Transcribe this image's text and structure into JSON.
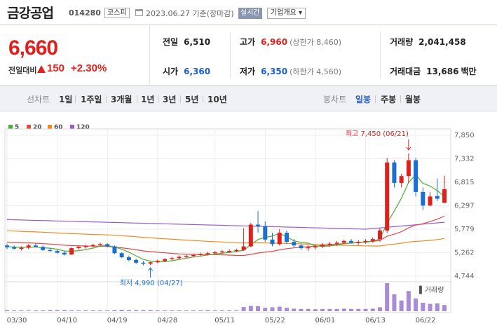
{
  "header": {
    "name": "금강공업",
    "code": "014280",
    "market": "코스피",
    "date": "2023.06.27 기준(장마감)",
    "realtime": "실시간",
    "overview": "기업개요 ▾"
  },
  "price": {
    "current": "6,660",
    "diff_label": "전일대비",
    "diff": "150",
    "rate": "+2.30%"
  },
  "stats": {
    "prev_label": "전일",
    "prev": "6,510",
    "high_label": "고가",
    "high": "6,960",
    "upper": "(상한가 8,460)",
    "volume_label": "거래량",
    "volume": "2,041,458",
    "open_label": "시가",
    "open": "6,360",
    "low_label": "저가",
    "low": "6,350",
    "lower": "(하한가 4,560)",
    "amount_label": "거래대금",
    "amount": "13,686",
    "amount_unit": "백만"
  },
  "tabs": {
    "line_label": "선차트",
    "line": [
      "1일",
      "1주일",
      "3개월",
      "1년",
      "3년",
      "5년",
      "10년"
    ],
    "candle_label": "봉차트",
    "candle": [
      "일봉",
      "주봉",
      "월봉"
    ]
  },
  "colors": {
    "up": "#e0201d",
    "down": "#1b6fd0",
    "ma5": "#4caf34",
    "ma20": "#e24a4a",
    "ma60": "#f08a1e",
    "ma120": "#9a5cc8",
    "volume": "#a98bd6"
  },
  "chart_data": {
    "type": "candlestick",
    "legend": [
      "5",
      "20",
      "60",
      "120"
    ],
    "y_ticks": [
      "7,850",
      "7,332",
      "6,815",
      "6,297",
      "5,779",
      "5,262",
      "4,744"
    ],
    "ylim": [
      4744,
      7850
    ],
    "x_ticks": [
      "03/30",
      "04/10",
      "04/19",
      "04/28",
      "05/11",
      "05/22",
      "06/01",
      "06/13",
      "06/22"
    ],
    "x_tick_index": [
      0,
      7,
      14,
      21,
      29,
      36,
      43,
      50,
      57
    ],
    "max_label": "최고 7,450 (06/21)",
    "max_index": 56,
    "max_value": 7450,
    "min_label": "최저 4,990 (04/27)",
    "min_index": 20,
    "min_value": 4990,
    "volume_label": "거래량",
    "candles": [
      [
        5420,
        5460,
        5340,
        5380
      ],
      [
        5380,
        5420,
        5330,
        5350
      ],
      [
        5350,
        5400,
        5310,
        5370
      ],
      [
        5370,
        5450,
        5340,
        5420
      ],
      [
        5420,
        5470,
        5380,
        5390
      ],
      [
        5390,
        5420,
        5300,
        5320
      ],
      [
        5320,
        5360,
        5280,
        5300
      ],
      [
        5300,
        5340,
        5240,
        5260
      ],
      [
        5260,
        5300,
        5200,
        5220
      ],
      [
        5220,
        5380,
        5210,
        5360
      ],
      [
        5360,
        5420,
        5330,
        5390
      ],
      [
        5390,
        5440,
        5350,
        5410
      ],
      [
        5410,
        5460,
        5380,
        5430
      ],
      [
        5430,
        5480,
        5400,
        5450
      ],
      [
        5450,
        5470,
        5380,
        5400
      ],
      [
        5400,
        5420,
        5230,
        5250
      ],
      [
        5250,
        5270,
        5140,
        5160
      ],
      [
        5160,
        5200,
        5070,
        5100
      ],
      [
        5100,
        5130,
        5010,
        5040
      ],
      [
        5040,
        5080,
        4980,
        5020
      ],
      [
        5020,
        5060,
        4990,
        5050
      ],
      [
        5050,
        5110,
        5030,
        5080
      ],
      [
        5080,
        5140,
        5060,
        5120
      ],
      [
        5120,
        5170,
        5090,
        5140
      ],
      [
        5140,
        5200,
        5110,
        5170
      ],
      [
        5170,
        5220,
        5140,
        5190
      ],
      [
        5190,
        5240,
        5160,
        5210
      ],
      [
        5210,
        5260,
        5180,
        5230
      ],
      [
        5230,
        5280,
        5200,
        5250
      ],
      [
        5250,
        5300,
        5220,
        5270
      ],
      [
        5270,
        5320,
        5240,
        5290
      ],
      [
        5290,
        5340,
        5260,
        5300
      ],
      [
        5300,
        5350,
        5270,
        5320
      ],
      [
        5320,
        5800,
        5300,
        5400
      ],
      [
        5400,
        5920,
        5380,
        5880
      ],
      [
        5880,
        6180,
        5700,
        5850
      ],
      [
        5850,
        5950,
        5500,
        5550
      ],
      [
        5550,
        5700,
        5400,
        5450
      ],
      [
        5450,
        5780,
        5420,
        5700
      ],
      [
        5700,
        5750,
        5450,
        5500
      ],
      [
        5500,
        5560,
        5380,
        5420
      ],
      [
        5420,
        5460,
        5320,
        5360
      ],
      [
        5360,
        5420,
        5300,
        5380
      ],
      [
        5380,
        5440,
        5330,
        5400
      ],
      [
        5400,
        5470,
        5360,
        5440
      ],
      [
        5440,
        5500,
        5390,
        5460
      ],
      [
        5460,
        5520,
        5410,
        5480
      ],
      [
        5480,
        5550,
        5450,
        5520
      ],
      [
        5520,
        5560,
        5460,
        5480
      ],
      [
        5480,
        5540,
        5440,
        5500
      ],
      [
        5500,
        5560,
        5460,
        5520
      ],
      [
        5520,
        5600,
        5480,
        5560
      ],
      [
        5560,
        5800,
        5500,
        5750
      ],
      [
        5750,
        7350,
        5700,
        7250
      ],
      [
        7250,
        7300,
        6700,
        6800
      ],
      [
        6800,
        7000,
        6700,
        6950
      ],
      [
        6950,
        7450,
        6800,
        7300
      ],
      [
        7300,
        7350,
        6500,
        6600
      ],
      [
        6600,
        6700,
        6200,
        6300
      ],
      [
        6300,
        6600,
        6280,
        6500
      ],
      [
        6510,
        6900,
        6400,
        6450
      ],
      [
        6360,
        6960,
        6350,
        6660
      ]
    ],
    "volumes": [
      4,
      3,
      3,
      3,
      3,
      3,
      4,
      4,
      4,
      3,
      3,
      3,
      3,
      3,
      3,
      4,
      5,
      4,
      4,
      4,
      4,
      3,
      3,
      3,
      3,
      3,
      3,
      3,
      4,
      3,
      3,
      3,
      3,
      15,
      19,
      18,
      12,
      14,
      16,
      12,
      9,
      8,
      8,
      7,
      8,
      8,
      8,
      9,
      8,
      8,
      8,
      9,
      14,
      100,
      60,
      38,
      72,
      45,
      30,
      26,
      28,
      22
    ]
  }
}
